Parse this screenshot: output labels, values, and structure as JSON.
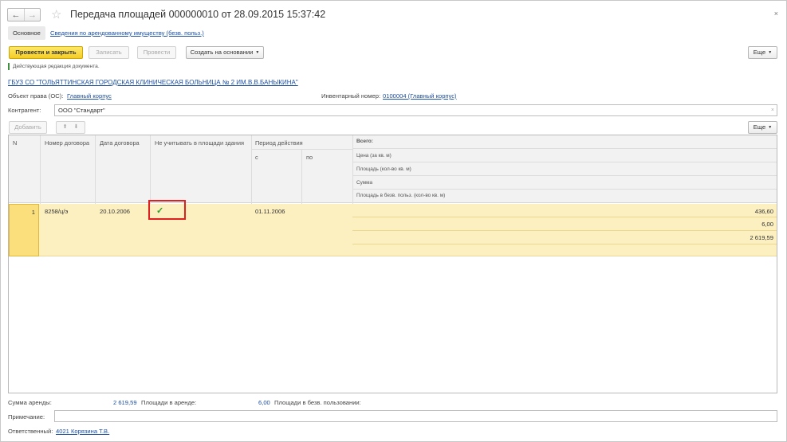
{
  "window": {
    "title": "Передача площадей 000000010 от 28.09.2015 15:37:42",
    "back_glyph": "←",
    "forward_glyph": "→",
    "star_glyph": "☆",
    "close_glyph": "×"
  },
  "tabs": {
    "main": "Основное",
    "link": "Сведения по арендованному имуществу (безв. польз.)"
  },
  "toolbar": {
    "post_close": "Провести и закрыть",
    "save": "Записать",
    "post": "Провести",
    "create_basis": "Создать на основании",
    "more": "Еще"
  },
  "note": "Действующая редакция документа.",
  "organization": "ГБУЗ СО \"ТОЛЬЯТТИНСКАЯ ГОРОДСКАЯ КЛИНИЧЕСКАЯ БОЛЬНИЦА № 2 ИМ.В.В.БАНЫКИНА\"",
  "object": {
    "label": "Объект права (ОС):",
    "value": "Главный корпус",
    "inv_label": "Инвентарный номер:",
    "inv_value": "0100004 (Главный корпус)"
  },
  "counterparty": {
    "label": "Контрагент:",
    "value": "ООО \"Стандарт\"",
    "clear_glyph": "×"
  },
  "table_toolbar": {
    "add": "Добавить",
    "up": "⬆",
    "down": "⬇",
    "more": "Еще"
  },
  "table": {
    "headers": {
      "n": "N",
      "contract_number": "Номер договора",
      "contract_date": "Дата договора",
      "exclude": "Не учитывать в площади здания",
      "period": "Период действия",
      "from": "с",
      "to": "по",
      "total": "Всего:",
      "price": "Цена (за кв. м)",
      "area": "Площадь (кол-во кв. м)",
      "sum": "Сумма",
      "free_area": "Площадь в безв. польз. (кол-во кв. м)"
    },
    "rows": [
      {
        "n": "1",
        "contract_number": "8258/ц/э",
        "contract_date": "20.10.2006",
        "exclude_check": "✓",
        "from": "01.11.2006",
        "to": "",
        "price": "436,60",
        "area": "6,00",
        "sum": "2 619,59"
      }
    ]
  },
  "footer": {
    "rent_sum_label": "Сумма аренды:",
    "rent_sum_value": "2 619,59",
    "rent_area_label": "Площади в аренде:",
    "rent_area_value": "6,00",
    "free_area_label": "Площади в безв. пользовании:",
    "comment_label": "Примечание:",
    "comment_value": "",
    "responsible_label": "Ответственный:",
    "responsible_value": "4021 Корязина Т.В."
  },
  "colors": {
    "accent_yellow": "#f4cc26",
    "link_blue": "#1d4fa0",
    "row_highlight": "#fcf0c0",
    "check_green": "#2ea02e",
    "annotation_red": "#e02020"
  }
}
